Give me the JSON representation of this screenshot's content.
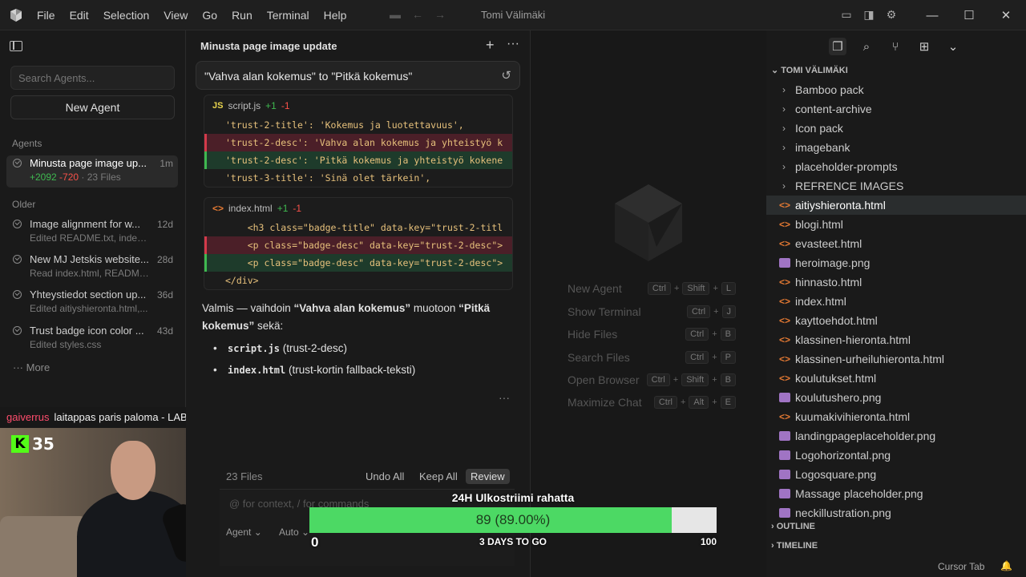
{
  "titlebar": {
    "menu": [
      "File",
      "Edit",
      "Selection",
      "View",
      "Go",
      "Run",
      "Terminal",
      "Help"
    ],
    "title": "Tomi Välimäki",
    "window_controls": [
      "minimize-icon",
      "maximize-icon",
      "close-icon"
    ]
  },
  "agents": {
    "search_placeholder": "Search Agents...",
    "new_agent_label": "New Agent",
    "section_label": "Agents",
    "older_label": "Older",
    "more_label": "More",
    "active": {
      "title": "Minusta page image up...",
      "time": "1m",
      "added": "+2092",
      "removed": "-720",
      "files": "· 23 Files"
    },
    "older": [
      {
        "title": "Image alignment for w...",
        "time": "12d",
        "subtitle": "Edited README.txt, index..."
      },
      {
        "title": "New MJ Jetskis website...",
        "time": "28d",
        "subtitle": "Read index.html, README..."
      },
      {
        "title": "Yhteystiedot section up...",
        "time": "36d",
        "subtitle": "Edited aitiyshieronta.html,..."
      },
      {
        "title": "Trust badge icon color ...",
        "time": "43d",
        "subtitle": "Edited styles.css"
      }
    ]
  },
  "stream_chat": {
    "user": "gaiverrus",
    "message": "laitappas paris paloma - LABOUR",
    "badge_number": "35",
    "badge_letter": "K"
  },
  "chat": {
    "panel_title": "Minusta page image update",
    "user_message": "\"Vahva alan kokemus\" to \"Pitkä kokemus\"",
    "diff1": {
      "icon": "JS",
      "file": "script.js",
      "added": "+1",
      "removed": "-1",
      "lines": [
        {
          "type": "ctx",
          "text": "'trust-2-title': 'Kokemus ja luotettavuus',"
        },
        {
          "type": "del",
          "text": "'trust-2-desc': 'Vahva alan kokemus ja yhteistyö k"
        },
        {
          "type": "add",
          "text": "'trust-2-desc': 'Pitkä kokemus ja yhteistyö kokene"
        },
        {
          "type": "ctx",
          "text": "'trust-3-title': 'Sinä olet tärkein',"
        }
      ]
    },
    "diff2": {
      "icon": "<>",
      "file": "index.html",
      "added": "+1",
      "removed": "-1",
      "lines": [
        {
          "type": "ctx",
          "text": "    <h3 class=\"badge-title\" data-key=\"trust-2-titl"
        },
        {
          "type": "del",
          "text": "    <p class=\"badge-desc\" data-key=\"trust-2-desc\">"
        },
        {
          "type": "add",
          "text": "    <p class=\"badge-desc\" data-key=\"trust-2-desc\">"
        },
        {
          "type": "ctx",
          "text": "</div>"
        }
      ]
    },
    "response_part1": "Valmis — vaihdoin ",
    "response_bold1": "“Vahva alan kokemus”",
    "response_part2": " muotoon ",
    "response_bold2": "“Pitkä kokemus”",
    "response_part3": " sekä:",
    "bullets": [
      {
        "code": "script.js",
        "text": " (trust-2-desc)"
      },
      {
        "code": "index.html",
        "text": " (trust-kortin fallback-teksti)"
      }
    ],
    "files_count": "23 Files",
    "undo_all": "Undo All",
    "keep_all": "Keep All",
    "review": "Review",
    "input_placeholder": "@ for context, / for commands",
    "mode": "Agent",
    "model": "Auto"
  },
  "editor": {
    "shortcuts": [
      {
        "label": "New Agent",
        "keys": [
          "Ctrl",
          "Shift",
          "L"
        ]
      },
      {
        "label": "Show Terminal",
        "keys": [
          "Ctrl",
          "J"
        ]
      },
      {
        "label": "Hide Files",
        "keys": [
          "Ctrl",
          "B"
        ]
      },
      {
        "label": "Search Files",
        "keys": [
          "Ctrl",
          "P"
        ]
      },
      {
        "label": "Open Browser",
        "keys": [
          "Ctrl",
          "Shift",
          "B"
        ]
      },
      {
        "label": "Maximize Chat",
        "keys": [
          "Ctrl",
          "Alt",
          "E"
        ]
      }
    ]
  },
  "progress": {
    "title": "24H Ulkostriimi rahatta",
    "value": 89,
    "fraction": 0.89,
    "text": "89 (89.00%)",
    "min": "0",
    "max": "100",
    "subtitle": "3 DAYS TO GO"
  },
  "explorer": {
    "root": "TOMI VÄLIMÄKI",
    "folders": [
      "Bamboo pack",
      "content-archive",
      "Icon pack",
      "imagebank",
      "placeholder-prompts",
      "REFRENCE IMAGES"
    ],
    "files": [
      {
        "name": "aitiyshieronta.html",
        "type": "html",
        "selected": true
      },
      {
        "name": "blogi.html",
        "type": "html"
      },
      {
        "name": "evasteet.html",
        "type": "html"
      },
      {
        "name": "heroimage.png",
        "type": "png"
      },
      {
        "name": "hinnasto.html",
        "type": "html"
      },
      {
        "name": "index.html",
        "type": "html"
      },
      {
        "name": "kayttoehdot.html",
        "type": "html"
      },
      {
        "name": "klassinen-hieronta.html",
        "type": "html"
      },
      {
        "name": "klassinen-urheiluhieronta.html",
        "type": "html"
      },
      {
        "name": "koulutukset.html",
        "type": "html"
      },
      {
        "name": "koulutushero.png",
        "type": "png"
      },
      {
        "name": "kuumakivihieronta.html",
        "type": "html"
      },
      {
        "name": "landingpageplaceholder.png",
        "type": "png"
      },
      {
        "name": "Logohorizontal.png",
        "type": "png"
      },
      {
        "name": "Logosquare.png",
        "type": "png"
      },
      {
        "name": "Massage placeholder.png",
        "type": "png"
      },
      {
        "name": "neckillustration.png",
        "type": "png"
      }
    ],
    "outline": "OUTLINE",
    "timeline": "TIMELINE"
  },
  "status": {
    "right": "Cursor Tab"
  },
  "colors": {
    "added": "#3fb950",
    "removed": "#f85149",
    "progress_fill": "#4cd964",
    "chat_user": "#ff4d6d"
  }
}
